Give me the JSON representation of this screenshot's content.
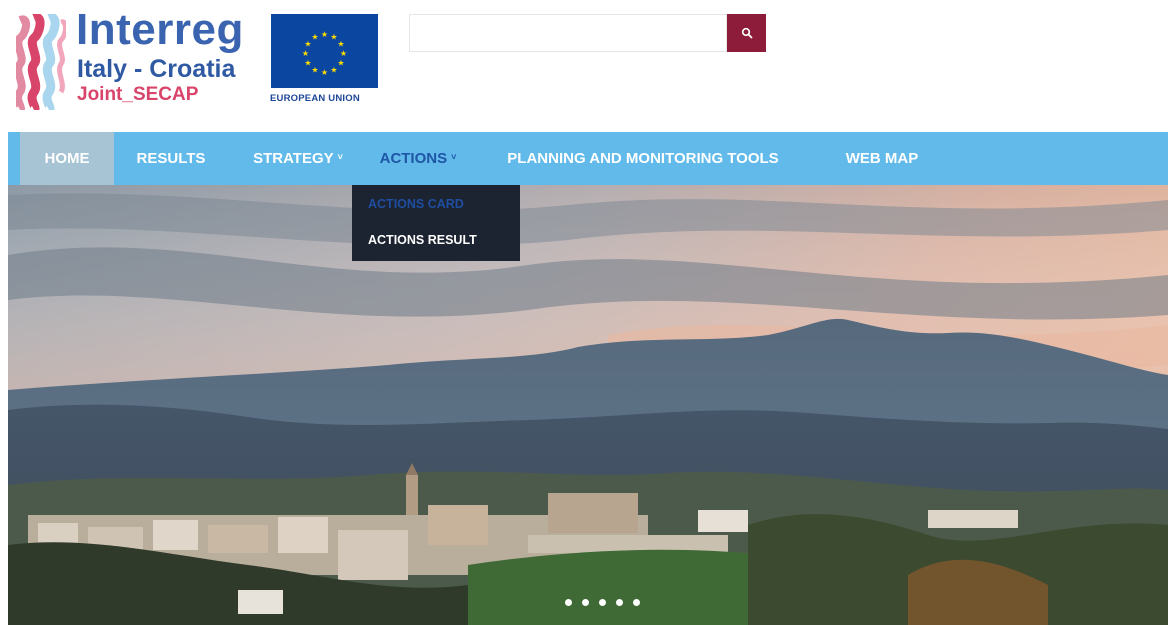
{
  "logo": {
    "title": "Interreg",
    "subtitle": "Italy - Croatia",
    "project": "Joint_SECAP"
  },
  "eu_badge": {
    "label": "EUROPEAN UNION",
    "flag_icon": "eu-flag-icon"
  },
  "search": {
    "value": "",
    "placeholder": "",
    "button_icon": "search-icon"
  },
  "colors": {
    "nav_bg": "#62baea",
    "nav_active_text": "#1f56a6",
    "home_bg": "#a6c4d4",
    "search_button": "#8c1c3a",
    "dropdown_bg": "#1c2331"
  },
  "nav": {
    "items": [
      {
        "label": "HOME"
      },
      {
        "label": "RESULTS"
      },
      {
        "label": "STRATEGY",
        "caret": "˅"
      },
      {
        "label": "ACTIONS",
        "caret": "˅"
      },
      {
        "label": "PLANNING AND MONITORING TOOLS"
      },
      {
        "label": "WEB MAP"
      }
    ]
  },
  "dropdown": {
    "items": [
      {
        "label": "ACTIONS CARD"
      },
      {
        "label": "ACTIONS RESULT"
      }
    ]
  },
  "carousel": {
    "slide_count": 5
  }
}
